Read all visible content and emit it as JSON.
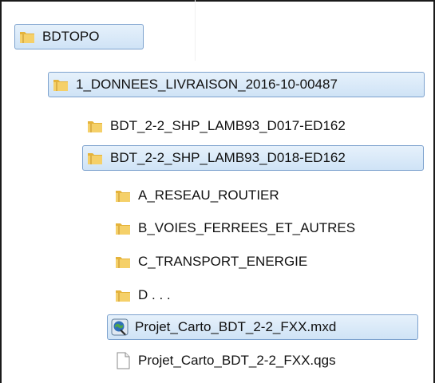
{
  "tree": {
    "items": [
      {
        "label": "BDTOPO",
        "icon": "folder-icon",
        "selected": true
      },
      {
        "label": "1_DONNEES_LIVRAISON_2016-10-00487",
        "icon": "folder-icon",
        "selected": true
      },
      {
        "label": "BDT_2-2_SHP_LAMB93_D017-ED162",
        "icon": "folder-icon",
        "selected": false
      },
      {
        "label": "BDT_2-2_SHP_LAMB93_D018-ED162",
        "icon": "folder-icon",
        "selected": true
      },
      {
        "label": "A_RESEAU_ROUTIER",
        "icon": "folder-icon",
        "selected": false
      },
      {
        "label": "B_VOIES_FERREES_ET_AUTRES",
        "icon": "folder-icon",
        "selected": false
      },
      {
        "label": "C_TRANSPORT_ENERGIE",
        "icon": "folder-icon",
        "selected": false
      },
      {
        "label": "D . . .",
        "icon": "folder-icon",
        "selected": false
      },
      {
        "label": "Projet_Carto_BDT_2-2_FXX.mxd",
        "icon": "arcmap-document-icon",
        "selected": true
      },
      {
        "label": "Projet_Carto_BDT_2-2_FXX.qgs",
        "icon": "blank-document-icon",
        "selected": false
      }
    ]
  },
  "colors": {
    "selection_fill": "#cfe3f6",
    "selection_border": "#7da2ce",
    "folder_yellow": "#f1c34a"
  }
}
